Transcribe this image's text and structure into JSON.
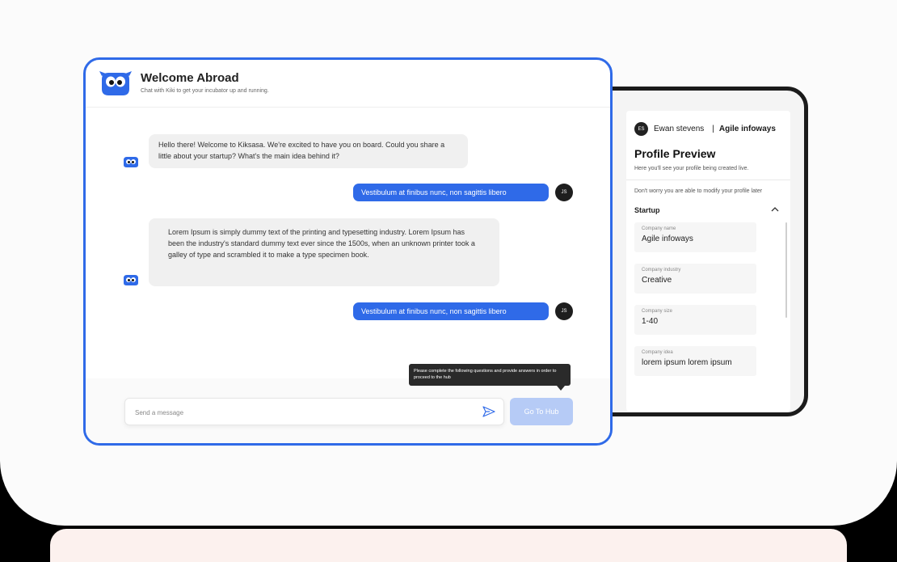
{
  "chat": {
    "title": "Welcome Abroad",
    "subtitle": "Chat with Kiki to get your incubator up and running.",
    "messages": [
      {
        "sender": "bot",
        "text": "Hello there! Welcome to Kiksasa. We're excited to have you on board. Could you share a little about your startup? What's the main idea behind it?"
      },
      {
        "sender": "user",
        "text": "Vestibulum at finibus nunc, non sagittis libero",
        "avatar": "JS"
      },
      {
        "sender": "bot",
        "text": "Lorem Ipsum is simply dummy text of the printing and typesetting industry. Lorem Ipsum has been the industry's standard dummy text ever since the 1500s, when an unknown printer took a galley of type and scrambled it to make a type specimen book."
      },
      {
        "sender": "user",
        "text": "Vestibulum at finibus nunc, non sagittis libero",
        "avatar": "JS"
      }
    ],
    "tooltip": "Please complete the following questions and provide answers in order to proceed to the hub",
    "input_placeholder": "Send a message",
    "hub_button": "Go To Hub"
  },
  "profile": {
    "user_initials": "ES",
    "user_name": "Ewan stevens",
    "separator": "|",
    "company": "Agile infoways",
    "title": "Profile Preview",
    "subtitle": "Here you'll see your profile being created live.",
    "note": "Don't worry you are able to modify your profile later",
    "section": "Startup",
    "fields": [
      {
        "label": "Company name",
        "value": "Agile infoways"
      },
      {
        "label": "Company industry",
        "value": "Creative"
      },
      {
        "label": "Company size",
        "value": "1-40"
      },
      {
        "label": "Company idea",
        "value": "lorem ipsum lorem ipsum"
      }
    ]
  },
  "colors": {
    "accent": "#2f6ae8",
    "button_disabled": "#b6cbf6",
    "bubble_bot": "#f0f0f0",
    "avatar_dark": "#1e1e1e",
    "strip": "#fcf1ee"
  },
  "icons": [
    "kiki-logo-icon",
    "bot-icon",
    "send-icon",
    "chevron-up-icon"
  ]
}
